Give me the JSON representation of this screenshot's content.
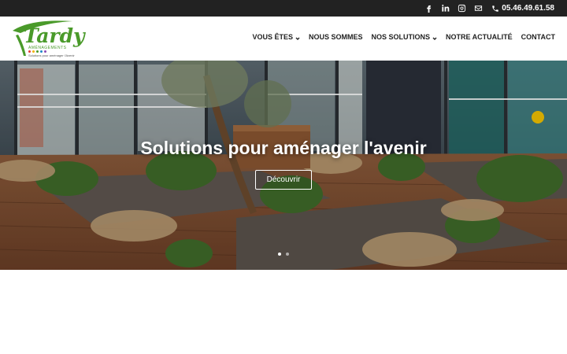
{
  "topbar": {
    "icons": [
      "facebook-icon",
      "linkedin-icon",
      "instagram-icon",
      "mail-icon"
    ],
    "phone": "05.46.49.61.58"
  },
  "logo": {
    "wordmark": "Tardy",
    "subtitle": "AMÉNAGEMENTS",
    "tagline": "Solutions pour aménager l'Avenir",
    "brand_color": "#4a9a2a",
    "dot_colors": [
      "#e63b2e",
      "#f2b000",
      "#4a9a2a",
      "#1e88c8",
      "#8a4bb5"
    ]
  },
  "nav": {
    "items": [
      {
        "label": "VOUS ÊTES",
        "dropdown": true
      },
      {
        "label": "NOUS SOMMES",
        "dropdown": false
      },
      {
        "label": "NOS SOLUTIONS",
        "dropdown": true
      },
      {
        "label": "NOTRE ACTUALITÉ",
        "dropdown": false
      },
      {
        "label": "CONTACT",
        "dropdown": false
      }
    ]
  },
  "hero": {
    "title": "Solutions pour aménager l'avenir",
    "button_label": "Découvrir",
    "slides_count": 2,
    "active_slide": 0
  }
}
